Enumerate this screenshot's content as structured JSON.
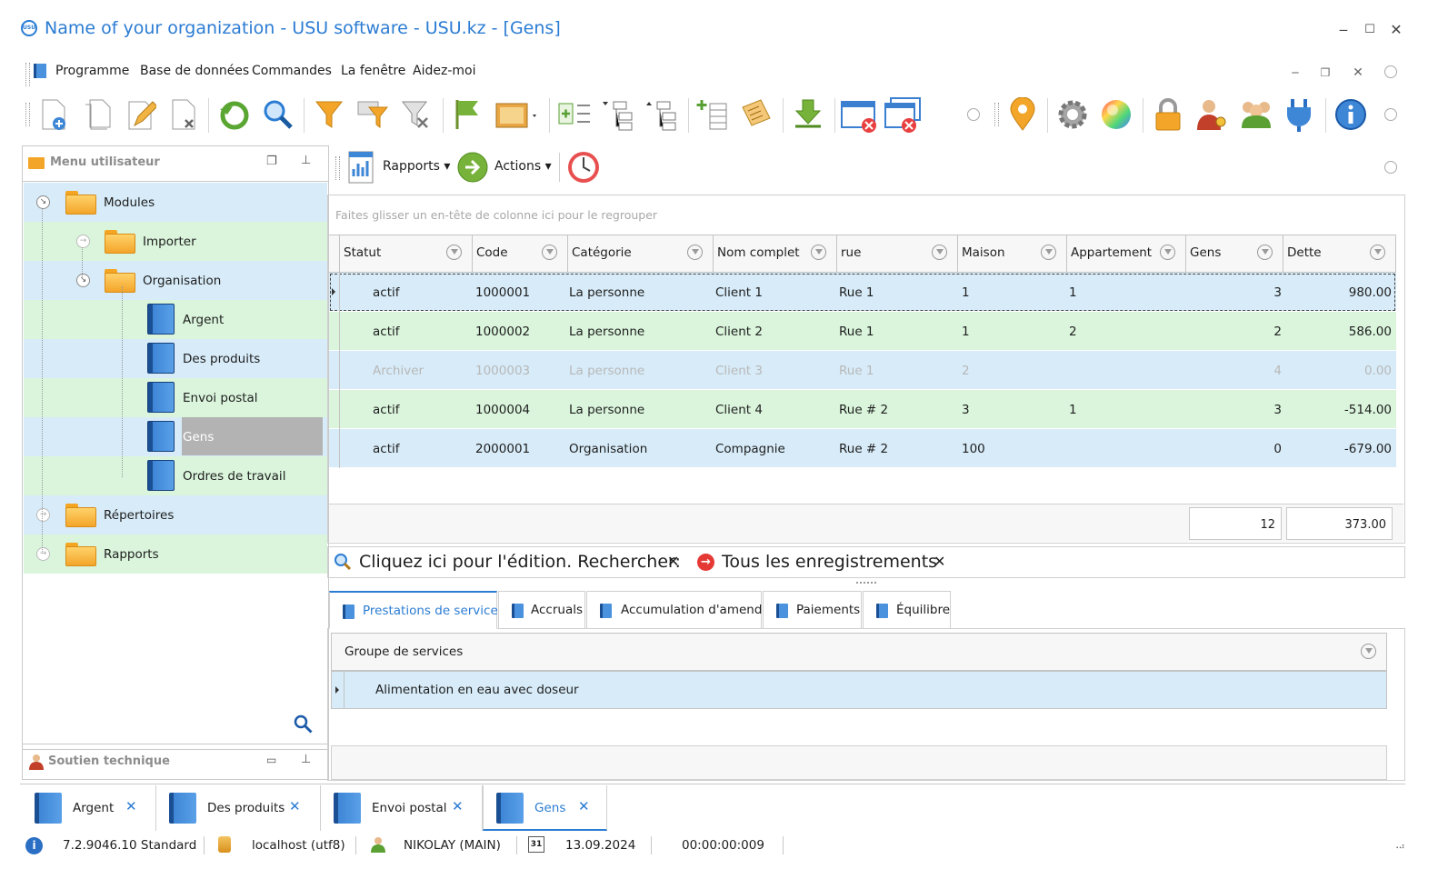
{
  "window": {
    "title": "Name of your organization - USU software - USU.kz - [Gens]",
    "logo_text": "USU"
  },
  "menubar": {
    "items": [
      "Programme",
      "Base de données",
      "Commandes",
      "La fenêtre",
      "Aidez-moi"
    ]
  },
  "left_panel": {
    "title": "Menu utilisateur",
    "tree": [
      {
        "label": "Modules"
      },
      {
        "label": "Importer"
      },
      {
        "label": "Organisation"
      },
      {
        "label": "Argent"
      },
      {
        "label": "Des produits"
      },
      {
        "label": "Envoi postal"
      },
      {
        "label": "Gens"
      },
      {
        "label": "Ordres de travail"
      },
      {
        "label": "Répertoires"
      },
      {
        "label": "Rapports"
      }
    ],
    "support_title": "Soutien technique"
  },
  "subtoolbar": {
    "reports_label": "Rapports",
    "actions_label": "Actions"
  },
  "grid": {
    "group_hint": "Faites glisser un en-tête de colonne ici pour le regrouper",
    "columns": [
      "Statut",
      "Code",
      "Catégorie",
      "Nom complet",
      "rue",
      "Maison",
      "Appartement",
      "Gens",
      "Dette"
    ],
    "rows": [
      {
        "statut": "actif",
        "code": "1000001",
        "categorie": "La personne",
        "nom": "Client 1",
        "rue": "Rue 1",
        "maison": "1",
        "appartement": "1",
        "gens": "3",
        "dette": "980.00"
      },
      {
        "statut": "actif",
        "code": "1000002",
        "categorie": "La personne",
        "nom": "Client 2",
        "rue": "Rue 1",
        "maison": "1",
        "appartement": "2",
        "gens": "2",
        "dette": "586.00"
      },
      {
        "statut": "Archiver",
        "code": "1000003",
        "categorie": "La personne",
        "nom": "Client 3",
        "rue": "Rue 1",
        "maison": "2",
        "appartement": "",
        "gens": "4",
        "dette": "0.00"
      },
      {
        "statut": "actif",
        "code": "1000004",
        "categorie": "La personne",
        "nom": "Client 4",
        "rue": "Rue # 2",
        "maison": "3",
        "appartement": "1",
        "gens": "3",
        "dette": "-514.00"
      },
      {
        "statut": "actif",
        "code": "2000001",
        "categorie": "Organisation",
        "nom": "Compagnie",
        "rue": "Rue # 2",
        "maison": "100",
        "appartement": "",
        "gens": "0",
        "dette": "-679.00"
      }
    ],
    "totals": {
      "gens": "12",
      "dette": "373.00"
    }
  },
  "filterbar": {
    "search_text": "Cliquez ici pour l'édition. Rechercher:",
    "filter_text": "Tous les enregistrements"
  },
  "detail_tabs": [
    "Prestations de service.",
    "Accruals",
    "Accumulation d'amendes",
    "Paiements",
    "Équilibre"
  ],
  "detail_grid": {
    "column": "Groupe de services",
    "rows": [
      "Alimentation en eau avec doseur"
    ]
  },
  "bottom_tabs": [
    "Argent",
    "Des produits",
    "Envoi postal",
    "Gens"
  ],
  "statusbar": {
    "version": "7.2.9046.10 Standard",
    "server": "localhost (utf8)",
    "user": "NIKOLAY (MAIN)",
    "calendar_day": "31",
    "date": "13.09.2024",
    "timer": "00:00:00:009"
  },
  "colors": {
    "accent": "#2b7cd3",
    "row_blue": "#d7ebf8",
    "row_green": "#daf5dc",
    "selected_gray": "#b3b3b3",
    "muted_text": "#b8b8b8"
  }
}
